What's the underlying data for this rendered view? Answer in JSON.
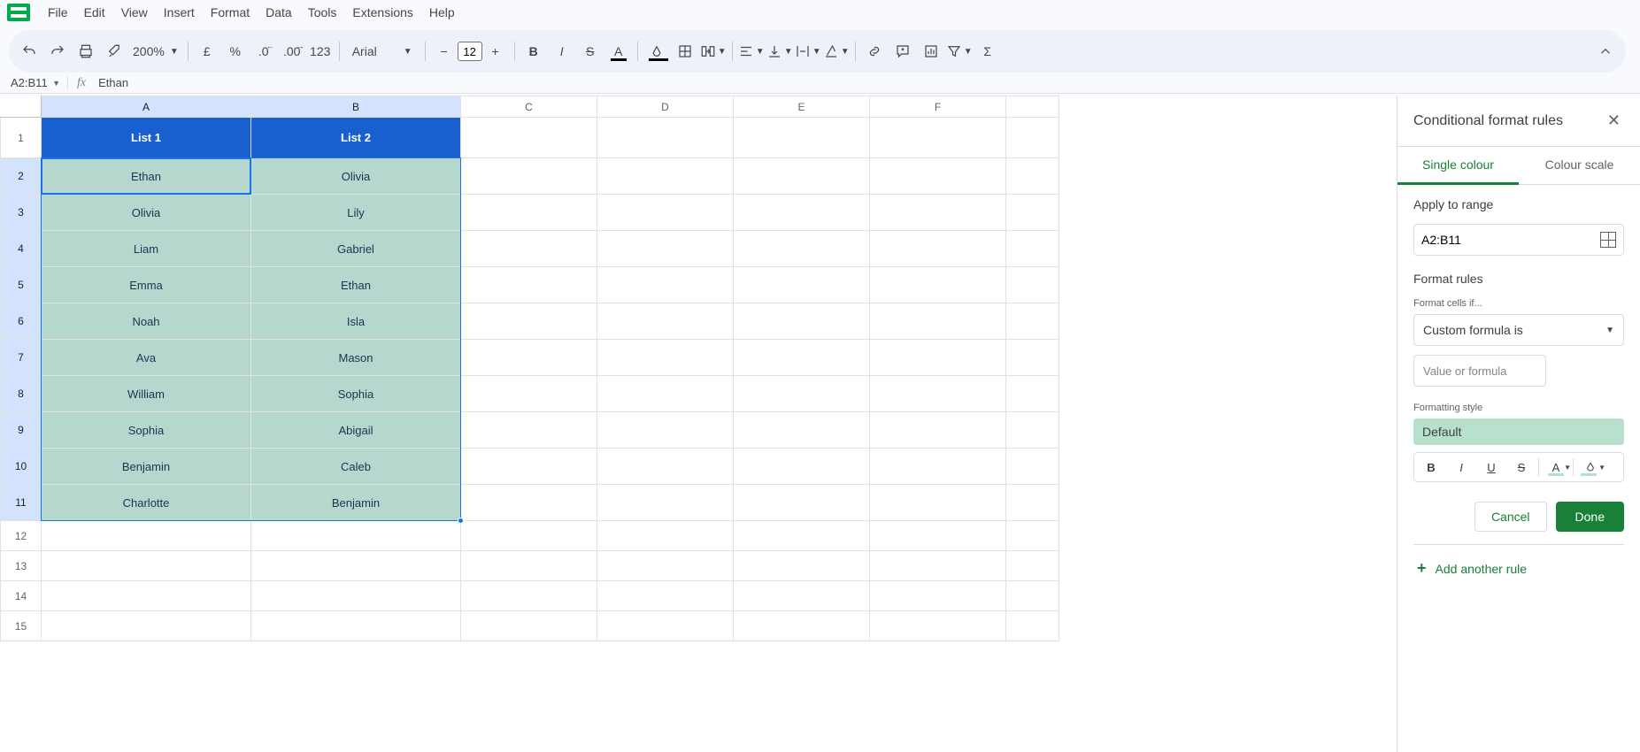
{
  "menu": {
    "items": [
      "File",
      "Edit",
      "View",
      "Insert",
      "Format",
      "Data",
      "Tools",
      "Extensions",
      "Help"
    ]
  },
  "toolbar": {
    "zoom": "200%",
    "font": "Arial",
    "font_size": "12"
  },
  "name_box": "A2:B11",
  "formula_value": "Ethan",
  "columns": [
    "A",
    "B",
    "C",
    "D",
    "E",
    "F"
  ],
  "headers": {
    "A": "List 1",
    "B": "List 2"
  },
  "rows": [
    {
      "A": "Ethan",
      "B": "Olivia"
    },
    {
      "A": "Olivia",
      "B": "Lily"
    },
    {
      "A": "Liam",
      "B": "Gabriel"
    },
    {
      "A": "Emma",
      "B": "Ethan"
    },
    {
      "A": "Noah",
      "B": "Isla"
    },
    {
      "A": "Ava",
      "B": "Mason"
    },
    {
      "A": "William",
      "B": "Sophia"
    },
    {
      "A": "Sophia",
      "B": "Abigail"
    },
    {
      "A": "Benjamin",
      "B": "Caleb"
    },
    {
      "A": "Charlotte",
      "B": "Benjamin"
    }
  ],
  "panel": {
    "title": "Conditional format rules",
    "tab_single": "Single colour",
    "tab_scale": "Colour scale",
    "apply_to_range": "Apply to range",
    "range_value": "A2:B11",
    "format_rules": "Format rules",
    "format_cells_if": "Format cells if...",
    "condition": "Custom formula is",
    "formula_placeholder": "Value or formula",
    "formatting_style": "Formatting style",
    "style_name": "Default",
    "cancel": "Cancel",
    "done": "Done",
    "add_rule": "Add another rule"
  }
}
